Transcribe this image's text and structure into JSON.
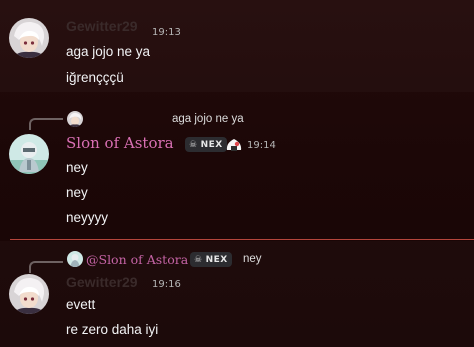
{
  "messages": [
    {
      "author": "Gewitter29",
      "time": "19:13",
      "lines": [
        "aga jojo ne ya",
        "iğrençççü"
      ]
    },
    {
      "reply": {
        "text": "aga jojo ne ya"
      },
      "author": "Slon of Astora",
      "clan_tag": "NEX",
      "time": "19:14",
      "lines": [
        "ney",
        "ney",
        "neyyyy"
      ]
    },
    {
      "reply": {
        "author": "@Slon of Astora",
        "clan_tag": "NEX",
        "text": "ney"
      },
      "author": "Gewitter29",
      "time": "19:16",
      "lines": [
        "evett",
        "re zero daha iyi"
      ]
    }
  ],
  "colors": {
    "background": "#1c0707",
    "accent_username": "#d86fb3",
    "new_messages_divider": "#b5463c"
  },
  "icons": [
    "avatar-white-hair",
    "avatar-astora",
    "skull-icon",
    "rice-ball-icon"
  ]
}
